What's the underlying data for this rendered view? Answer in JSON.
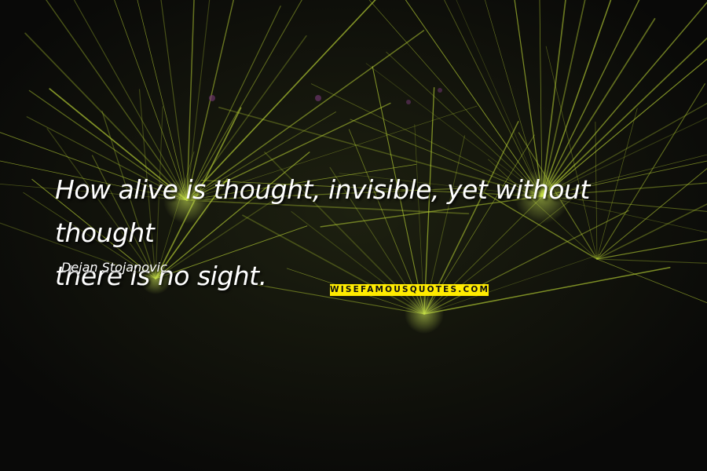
{
  "quote": {
    "lines": [
      "How alive is thought, invisible, yet without thought",
      "there is no sight."
    ],
    "author": "Dejan Stojanovic"
  },
  "brand": {
    "logo_text": "WISEFAMOUSQUOTES.COM",
    "background_color": "#ffeb00",
    "text_color": "#111111"
  },
  "background": {
    "base_color": "#0b0b0a",
    "laser_color": "#b3cc33"
  }
}
